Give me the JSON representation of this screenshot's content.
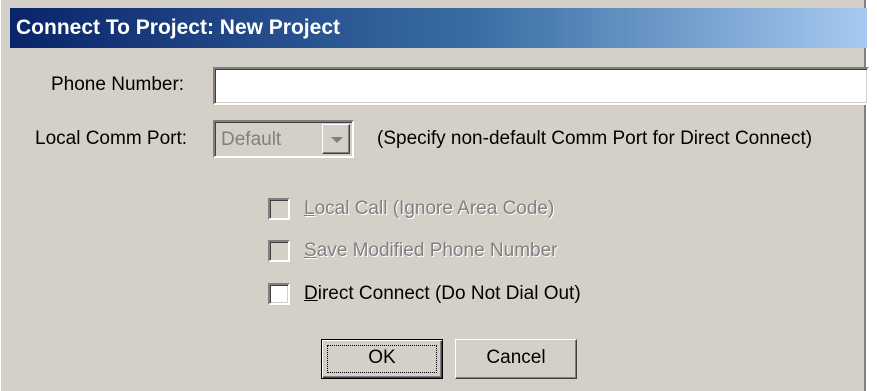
{
  "window": {
    "title": "Connect To Project:  New Project"
  },
  "phone": {
    "label": "Phone Number:",
    "value": ""
  },
  "comm_port": {
    "label": "Local Comm Port:",
    "selected": "Default",
    "hint": "(Specify non-default Comm Port for Direct Connect)"
  },
  "options": [
    {
      "underline": "L",
      "rest": "ocal Call (Ignore Area Code)",
      "enabled": false,
      "checked": false
    },
    {
      "underline": "S",
      "rest": "ave Modified Phone Number",
      "enabled": false,
      "checked": false
    },
    {
      "underline": "D",
      "rest": "irect Connect (Do Not Dial Out)",
      "enabled": true,
      "checked": false
    }
  ],
  "buttons": {
    "ok": "OK",
    "cancel": "Cancel"
  },
  "colors": {
    "dialog_face": "#d4d0c8",
    "title_start": "#0a246a",
    "title_end": "#a6caf0",
    "disabled_text": "#808080"
  }
}
